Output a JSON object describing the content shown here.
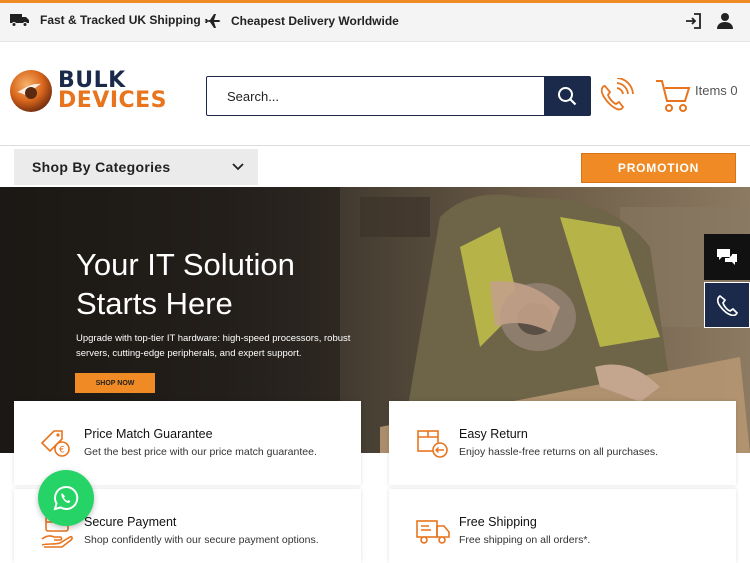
{
  "topbar": {
    "shipping_text": "Fast & Tracked UK Shipping",
    "delivery_text": "Cheapest Delivery Worldwide"
  },
  "header": {
    "logo_line1": "BULK",
    "logo_line2": "DEVICES",
    "search_placeholder": "Search...",
    "cart_label": "Items 0"
  },
  "nav": {
    "categories_label": "Shop By Categories",
    "promotion_label": "PROMOTION"
  },
  "hero": {
    "title_line1": "Your IT Solution",
    "title_line2": "Starts Here",
    "subtitle": "Upgrade with top-tier IT hardware: high-speed processors, robust servers, cutting-edge peripherals, and expert support.",
    "cta_label": "SHOP NOW"
  },
  "features": [
    {
      "title": "Price Match Guarantee",
      "desc": "Get the best price with our price match guarantee.",
      "icon": "price-tag-icon"
    },
    {
      "title": "Easy Return",
      "desc": "Enjoy hassle-free returns on all purchases.",
      "icon": "return-box-icon"
    },
    {
      "title": "Secure Payment",
      "desc": "Shop confidently with our secure payment options.",
      "icon": "secure-payment-icon"
    },
    {
      "title": "Free Shipping",
      "desc": "Free shipping on all orders*.",
      "icon": "delivery-truck-icon"
    }
  ],
  "colors": {
    "accent": "#f08a24",
    "navy": "#1b2a4a",
    "whatsapp": "#25d366"
  }
}
